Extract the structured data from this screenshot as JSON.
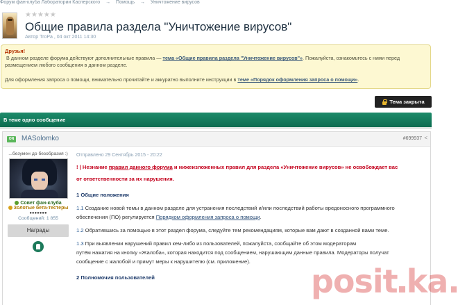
{
  "breadcrumbs": [
    "Форум фан-клуба Лаборатории Касперского",
    "→",
    "Помощь",
    "→",
    "Уничтожение вирусов"
  ],
  "topic": {
    "stars": "★★★★★",
    "title": "Общие правила раздела \"Уничтожение вирусов\"",
    "meta": "Автор TroPa , 04 окт 2011 14:30"
  },
  "notice": {
    "greeting": "Друзья!",
    "p1_before": "В данном разделе форума действуют дополнительные правила — ",
    "p1_link": "тема «Общие правила раздела \"Уничтожение вирусов\"»",
    "p1_after": ". Пожалуйста, ознакомьтесь с ними перед",
    "p1_line2": "размещением любого сообщения в данном разделе.",
    "p2_before": "Для оформления запроса о помощи, внимательно прочитайте и аккуратно выполните инструкции в ",
    "p2_link": "теме «Порядок оформления запроса о помощи»",
    "p2_after": "."
  },
  "closed_label": "Тема закрыта",
  "bar_label": "В теме одно сообщение",
  "post": {
    "online_badge": "ON",
    "author": "MASolomko",
    "number": "#699937",
    "status": "...безумен до безобразия :)",
    "group1": "Совет фан-клуба",
    "group2": "Золотые бета-тестеры",
    "pips": "●●●●●●●",
    "messages": "Сообщений: 1 855",
    "awards_label": "Награды",
    "sent": "Отправлено 29 Сентябрь 2015 - 20:22",
    "warn_prefix": "! | Незнание ",
    "warn_link": "правил данного форума",
    "warn_rest": " и нижеизложенных правил для раздела «Уничтожение вирусов» не освобождает вас",
    "warn_line2": "от ответственности за их нарушения.",
    "h1": "1 Общие положения",
    "p11_num": "1.1",
    "p11_text": " Создание новой темы в данном разделе для устранения последствий и/или последствий работы вредоносного программного",
    "p11_line2_before": "обеспечения (ПО) регулируется ",
    "p11_link": "Порядком оформления запроса о помощи",
    "p11_line2_after": ".",
    "p12_num": "1.2",
    "p12_text": " Обратившись за помощью в этот раздел форума, следуйте тем рекомендациям, которые вам дают в созданной вами теме.",
    "p13_num": "1.3",
    "p13_text": " При выявлении нарушений правил кем-либо из пользователей, пожалуйста, сообщайте об этом модераторам",
    "p13_line2": "путём нажатия на кнопку «Жалоба», которая находится под сообщением, нарушающим данные правила. Модераторы получат",
    "p13_line3": "сообщение с жалобой и примут меры к нарушителю (см. приложение).",
    "h2": "2 Полномочия пользователей"
  },
  "watermark": {
    "left": "posit",
    "right": "ka.ru"
  },
  "colors": {
    "bar_green": "#0b6c4f",
    "warn_red": "#c3001c",
    "notice_bg": "#fdf8d2"
  }
}
